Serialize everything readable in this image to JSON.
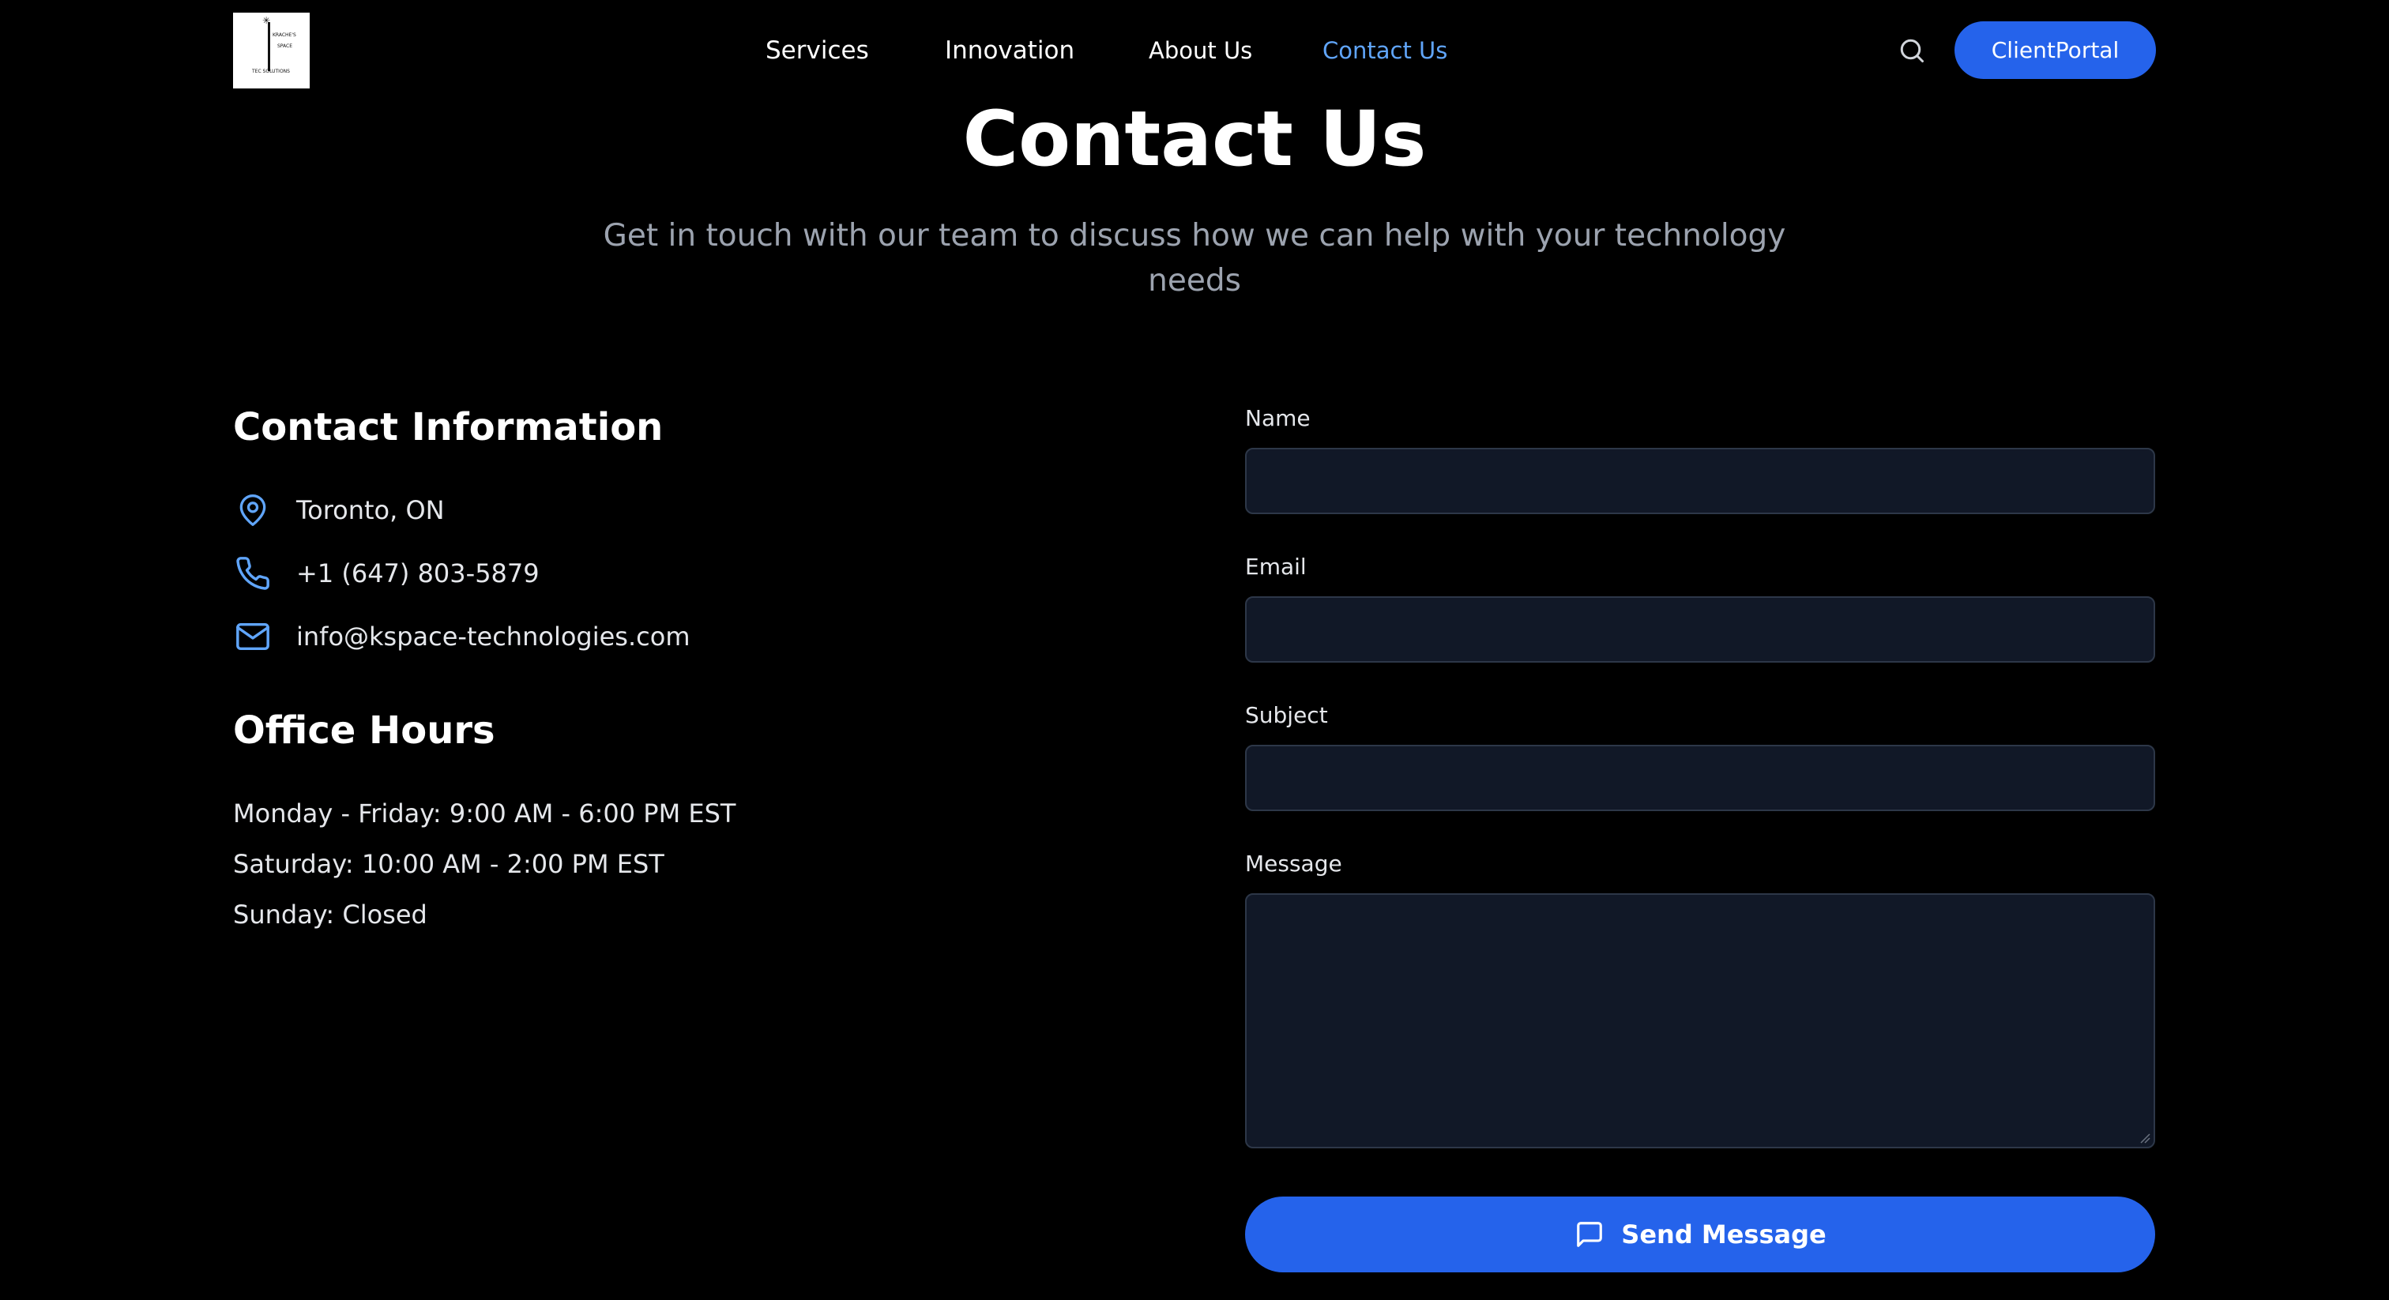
{
  "header": {
    "logo": {
      "alt": "logo",
      "lines": [
        "KRACHE'S",
        "SPACE",
        "TEC SOLUTIONS"
      ]
    },
    "nav": {
      "services": "Services",
      "innovation": "Innovation",
      "about": "About Us",
      "contact": "Contact Us",
      "active": "contact"
    },
    "search_icon": "search-icon",
    "client_portal_label": "ClientPortal"
  },
  "hero": {
    "title": "Contact Us",
    "subtitle": "Get in touch with our team to discuss how we can help with your technology needs"
  },
  "contact_info": {
    "heading": "Contact Information",
    "items": [
      {
        "icon": "map-pin-icon",
        "text": "Toronto, ON"
      },
      {
        "icon": "phone-icon",
        "text": "+1 (647) 803-5879"
      },
      {
        "icon": "mail-icon",
        "text": "info@kspace-technologies.com"
      }
    ]
  },
  "office_hours": {
    "heading": "Office Hours",
    "lines": [
      "Monday - Friday: 9:00 AM - 6:00 PM EST",
      "Saturday: 10:00 AM - 2:00 PM EST",
      "Sunday: Closed"
    ]
  },
  "form": {
    "name_label": "Name",
    "name_value": "",
    "email_label": "Email",
    "email_value": "",
    "subject_label": "Subject",
    "subject_value": "",
    "message_label": "Message",
    "message_value": "",
    "submit_label": "Send Message",
    "submit_icon": "message-square-icon"
  },
  "colors": {
    "background": "#000000",
    "accent": "#2563eb",
    "active_link": "#60a5fa",
    "icon": "#60a5fa",
    "input_bg": "#111827",
    "muted_text": "#9ca3af"
  }
}
